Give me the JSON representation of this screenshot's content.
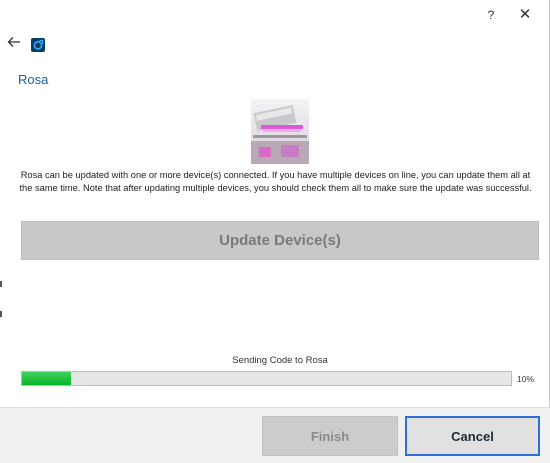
{
  "titlebar": {
    "help_label": "?",
    "close_label": "✕"
  },
  "nav": {
    "back_icon": "back-arrow-icon",
    "app_icon": "refresh-update-icon"
  },
  "page": {
    "title": "Rosa",
    "description": "Rosa can be updated with one or more device(s) connected. If you have multiple devices on line, you can update them all at the same time. Note that after updating multiple devices, you should check them all to make sure the update was successful."
  },
  "actions": {
    "update_label": "Update Device(s)",
    "update_enabled": false
  },
  "progress": {
    "status": "Sending Code to Rosa",
    "percent_label": "10%",
    "percent": 10,
    "fill_color": "#08b52c"
  },
  "footer": {
    "finish_label": "Finish",
    "finish_enabled": false,
    "cancel_label": "Cancel",
    "cancel_focus_color": "#2b6fd6"
  }
}
